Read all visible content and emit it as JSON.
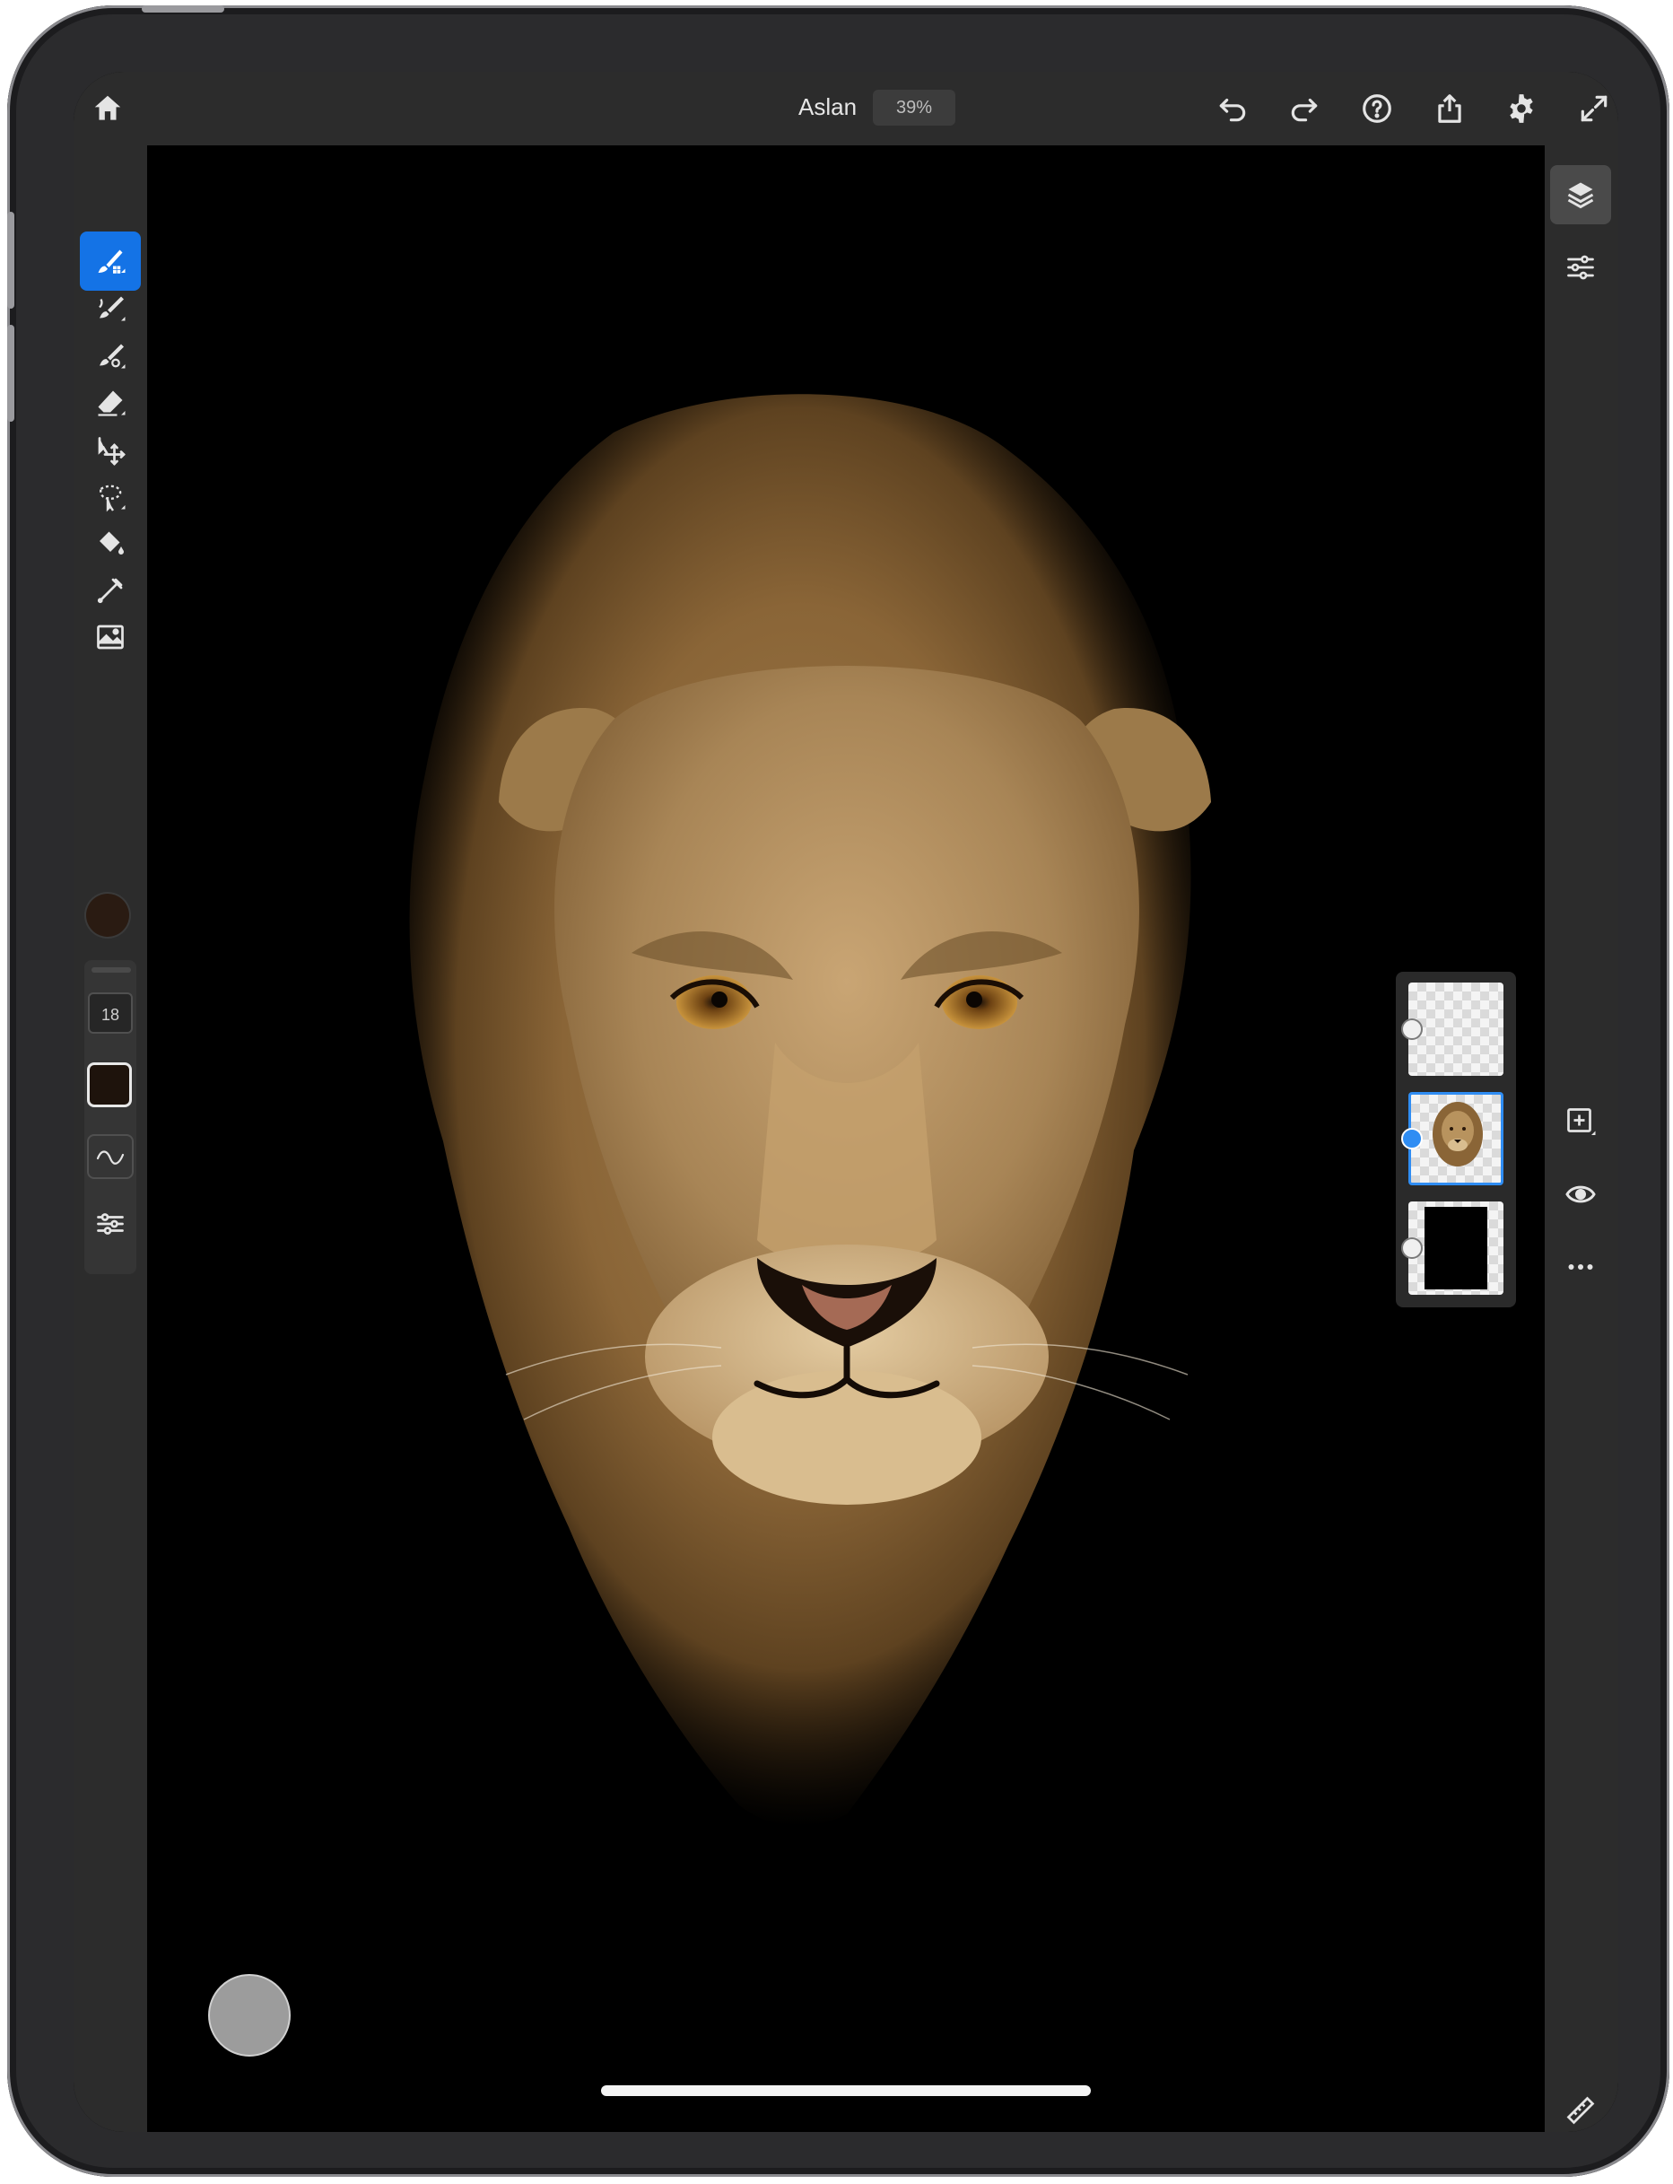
{
  "app": {
    "document_title": "Aslan",
    "zoom_level": "39%"
  },
  "toolbar": {
    "brush_size": "18"
  },
  "colors": {
    "accent": "#1473e6",
    "active_color": "#2a1b12",
    "panel_bg": "#2c2c2c",
    "canvas_bg": "#000000"
  },
  "top_icons": [
    "home-icon",
    "undo-icon",
    "redo-icon",
    "help-icon",
    "share-icon",
    "settings-icon",
    "fullscreen-icon"
  ],
  "left_tools": [
    "pixel-brush-icon",
    "live-brush-icon",
    "vector-brush-icon",
    "eraser-icon",
    "transform-icon",
    "selection-icon",
    "fill-icon",
    "eyedropper-icon",
    "image-icon"
  ],
  "right_tools": [
    "layers-icon",
    "layer-properties-icon",
    "add-layer-icon",
    "visibility-icon",
    "more-icon",
    "ruler-icon"
  ],
  "layers": [
    {
      "type": "empty"
    },
    {
      "type": "painting",
      "selected": true
    },
    {
      "type": "background"
    }
  ]
}
